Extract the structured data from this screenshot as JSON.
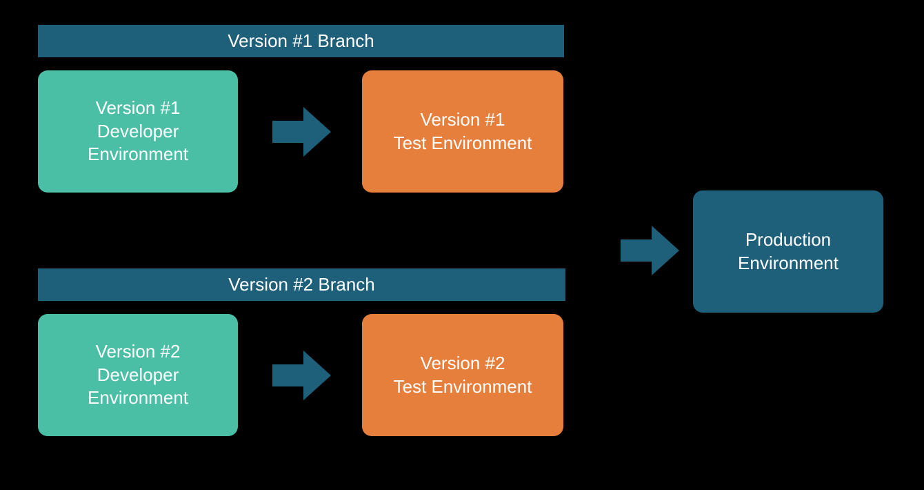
{
  "branches": {
    "v1": {
      "header": "Version #1 Branch",
      "dev": "Version #1\nDeveloper\nEnvironment",
      "test": "Version #1\nTest Environment"
    },
    "v2": {
      "header": "Version #2 Branch",
      "dev": "Version #2\nDeveloper\nEnvironment",
      "test": "Version #2\nTest Environment"
    }
  },
  "production": "Production\nEnvironment",
  "colors": {
    "branch_header": "#1e5f7a",
    "dev_box": "#4bbfa6",
    "test_box": "#e67e3c",
    "prod_box": "#1e5f7a",
    "arrow": "#1e5f7a"
  }
}
